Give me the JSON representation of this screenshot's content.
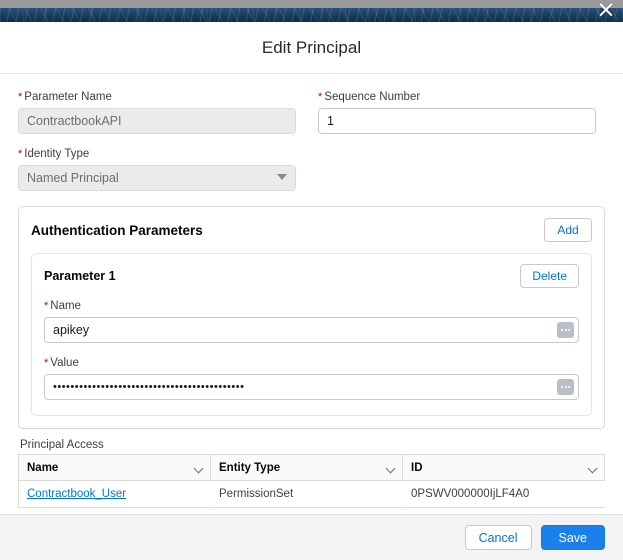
{
  "window": {
    "close_label": "×"
  },
  "modal": {
    "title": "Edit Principal",
    "fields": {
      "parameter_name": {
        "label": "Parameter Name",
        "required_marker": "*",
        "value": "ContractbookAPI"
      },
      "sequence_number": {
        "label": "Sequence Number",
        "required_marker": "*",
        "value": "1"
      },
      "identity_type": {
        "label": "Identity Type",
        "required_marker": "*",
        "value": "Named Principal"
      }
    },
    "auth_params": {
      "title": "Authentication Parameters",
      "add_label": "Add",
      "parameter": {
        "title": "Parameter 1",
        "delete_label": "Delete",
        "name": {
          "label": "Name",
          "required_marker": "*",
          "value": "apikey"
        },
        "value": {
          "label": "Value",
          "required_marker": "*",
          "value": "••••••••••••••••••••••••••••••••••••••••••••"
        }
      }
    },
    "principal_access": {
      "label": "Principal Access",
      "columns": [
        "Name",
        "Entity Type",
        "ID"
      ],
      "rows": [
        {
          "name": "Contractbook_User",
          "entity_type": "PermissionSet",
          "id": "0PSWV000000IjLF4A0"
        }
      ]
    },
    "footer": {
      "cancel_label": "Cancel",
      "save_label": "Save"
    }
  },
  "colors": {
    "brand_blue": "#1b81ea",
    "link_blue": "#0176d3",
    "required_red": "#ba0517",
    "banner_navy": "#1d3f63",
    "backdrop_gray": "#9a9a9a"
  }
}
